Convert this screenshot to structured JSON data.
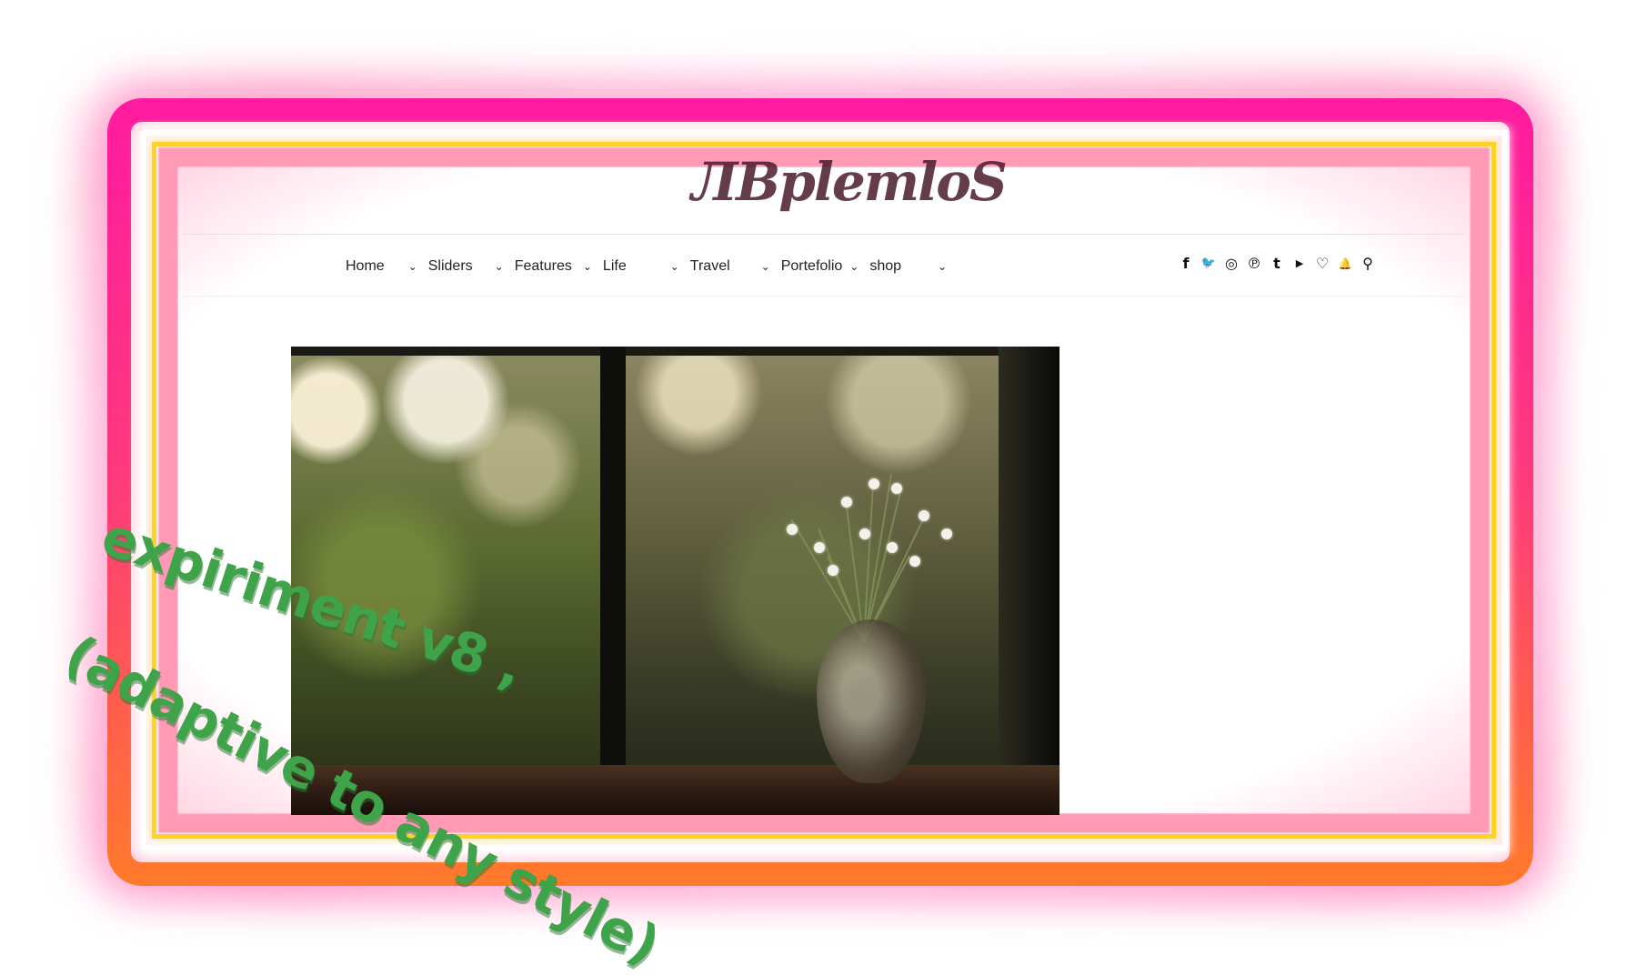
{
  "brand": {
    "logo_text": "ЛBplemloS"
  },
  "nav": {
    "items": [
      {
        "label": "Home"
      },
      {
        "label": "Sliders"
      },
      {
        "label": "Features"
      },
      {
        "label": "Life"
      },
      {
        "label": "Travel"
      },
      {
        "label": "Portefolio"
      },
      {
        "label": "shop"
      }
    ],
    "chevron": "⌄"
  },
  "social": {
    "icons": [
      "facebook-icon",
      "twitter-icon",
      "instagram-icon",
      "pinterest-icon",
      "tumblr-icon",
      "youtube-icon",
      "heart-icon",
      "bell-icon",
      "search-icon"
    ],
    "glyphs": [
      "f",
      "🐦",
      "◎",
      "℗",
      "t",
      "▶",
      "♡",
      "🔔",
      "⚲"
    ]
  },
  "overlay": {
    "line1": "expiriment v8 ,",
    "line2": "(adaptive to any style)"
  },
  "colors": {
    "frame_top": "#ff1aa0",
    "frame_bottom": "#ff7a2a",
    "frame_yellow": "#ffd22a",
    "overlay_text": "#3fa34a"
  }
}
